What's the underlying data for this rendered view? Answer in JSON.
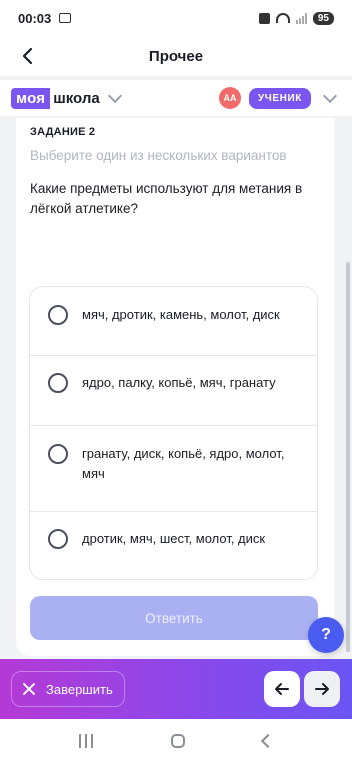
{
  "status_bar": {
    "time": "00:03",
    "battery": "95"
  },
  "header": {
    "title": "Прочее"
  },
  "school": {
    "logo_part1": "моя",
    "logo_part2": "школа",
    "avatar_initials": "АА",
    "role": "УЧЕНИК"
  },
  "task": {
    "label": "ЗАДАНИЕ 2",
    "hint": "Выберите один из нескольких вариантов",
    "question": "Какие предметы используют для метания в лёгкой атлетике?",
    "options": [
      "мяч, дротик, камень, молот, диск",
      "ядро, палку, копьё, мяч, гранату",
      "гранату, диск, копьё, ядро, молот, мяч",
      "дротик, мяч, шест, молот, диск"
    ],
    "answer_label": "Ответить"
  },
  "help": {
    "label": "?"
  },
  "bottom_bar": {
    "finish_label": "Завершить"
  },
  "icons": {
    "back": "back-arrow-icon",
    "close": "close-icon",
    "prev": "arrow-left-icon",
    "next": "arrow-right-icon"
  },
  "colors": {
    "brand": "#7a55f0",
    "answer_disabled": "#a9b1f3",
    "help": "#4a5cf0",
    "avatar": "#f26b6b"
  }
}
